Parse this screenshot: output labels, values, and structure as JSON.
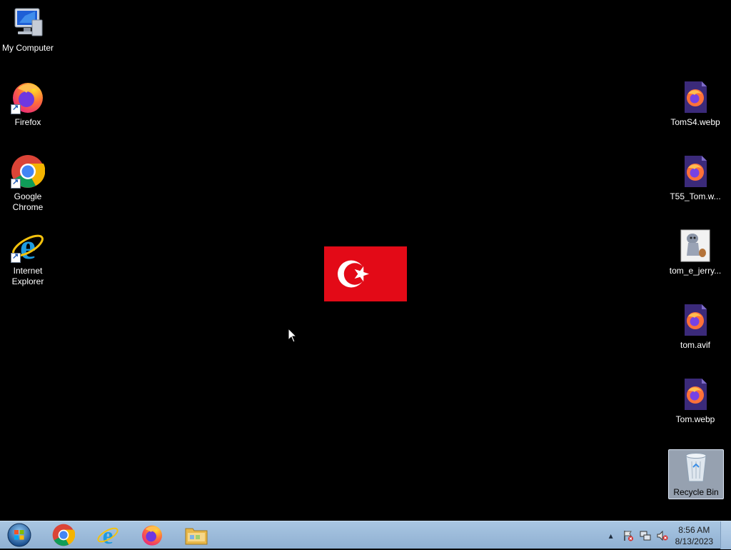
{
  "desktop": {
    "left_icons": [
      {
        "label": "My Computer",
        "icon": "computer-icon"
      },
      {
        "label": "Firefox",
        "icon": "firefox-icon"
      },
      {
        "label": "Google Chrome",
        "icon": "chrome-icon"
      },
      {
        "label": "Internet Explorer",
        "icon": "internet-explorer-icon"
      }
    ],
    "right_icons": [
      {
        "label": "TomS4.webp",
        "icon": "firefox-file-icon"
      },
      {
        "label": "T55_Tom.w...",
        "icon": "firefox-file-icon"
      },
      {
        "label": "tom_e_jerry...",
        "icon": "image-thumbnail-icon"
      },
      {
        "label": "tom.avif",
        "icon": "firefox-file-icon"
      },
      {
        "label": "Tom.webp",
        "icon": "firefox-file-icon"
      },
      {
        "label": "Recycle Bin",
        "icon": "recycle-bin-icon"
      }
    ],
    "wallpaper_flag": {
      "name": "turkish-flag",
      "colors": {
        "red": "#e30a17",
        "white": "#ffffff"
      }
    }
  },
  "taskbar": {
    "pinned": [
      "start-orb-icon",
      "chrome-icon",
      "internet-explorer-icon",
      "firefox-icon",
      "file-explorer-icon"
    ],
    "clock": {
      "time": "8:56 AM",
      "date": "8/13/2023"
    },
    "tray": [
      "show-hidden-icons-arrow",
      "action-center-flag-icon",
      "network-icon",
      "volume-muted-icon"
    ]
  }
}
